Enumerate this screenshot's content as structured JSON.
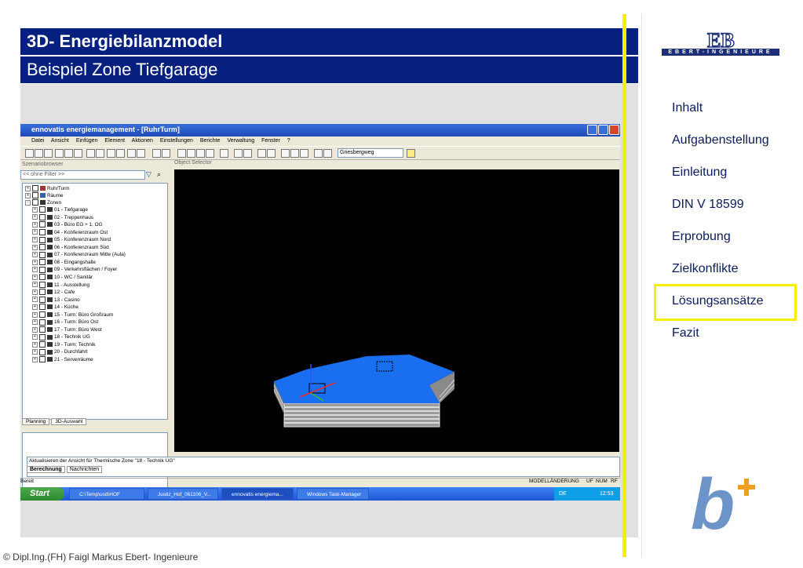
{
  "slide": {
    "title": "3D- Energiebilanzmodel",
    "subtitle": "Beispiel Zone Tiefgarage",
    "footer": "© Dipl.Ing.(FH) Faigl Markus Ebert- Ingenieure",
    "logo_text": "EBERT-INGENIEURE"
  },
  "nav": {
    "items": [
      {
        "label": "Inhalt"
      },
      {
        "label": "Aufgabenstellung"
      },
      {
        "label": "Einleitung"
      },
      {
        "label": "DIN V 18599"
      },
      {
        "label": "Erprobung"
      },
      {
        "label": "Zielkonflikte"
      },
      {
        "label": "Lösungsansätze"
      },
      {
        "label": "Fazit"
      }
    ],
    "active_index": 6,
    "highlight_color": "#f5f000"
  },
  "app": {
    "window_title": "ennovatis energiemanagement - [RuhrTurm]",
    "menu": [
      "Datei",
      "Ansicht",
      "Einfügen",
      "Element",
      "Aktionen",
      "Einstellungen",
      "Berichte",
      "Verwaltung",
      "Fenster",
      "?"
    ],
    "zone_dropdown": "Griesbergweg",
    "scenario_header": "Szenariobrowser",
    "filter_placeholder": "<< ohne Filter >>",
    "object_selector_header": "Object Selector",
    "tree_roots": [
      "RuhrTurm",
      "Räume",
      "Zonen"
    ],
    "zones": [
      "01 - Tiefgarage",
      "02 - Treppenhaus",
      "03 - Büro EG + 1. OG",
      "04 - Konferenzraum Ost",
      "05 - Konferenzraum Nord",
      "06 - Konferenzraum Süd",
      "07 - Konferenzraum Mitte (Aula)",
      "08 - Eingangshalle",
      "09 - Verkehrsflächen / Foyer",
      "10 - WC / Sanitär",
      "11 - Ausstellung",
      "12 - Cafe",
      "13 - Casino",
      "14 - Küche",
      "15 - Turm: Büro Großraum",
      "16 - Turm: Büro Ost",
      "17 - Turm: Büro West",
      "18 - Technik UG",
      "19 - Turm: Technik",
      "20 - Durchfahrt",
      "21 - Serverräume"
    ],
    "left_tabs": [
      "Planning",
      "3D-Auswahl"
    ],
    "status_message": "Aktualisieren der Ansicht für Thermische Zone \"18 - Technik UG\"",
    "bottom_tabs": [
      "Berechnung",
      "Nachrichten"
    ],
    "status_left": "Bereit",
    "status_right": [
      "MODELLÄNDERUNG",
      "UF",
      "NUM",
      "RF"
    ],
    "taskbar": {
      "start": "Start",
      "tasks": [
        "C:\\Temp\\usd\\HOF",
        "Justiz_Hof_061106_V...",
        "ennovatis energiema...",
        "Windows Task-Manager"
      ],
      "lang": "DE",
      "clock": "12:53"
    }
  },
  "colors": {
    "header_blue": "#062080",
    "model_blue": "#1a6ff0",
    "yellow": "#f5f000"
  }
}
